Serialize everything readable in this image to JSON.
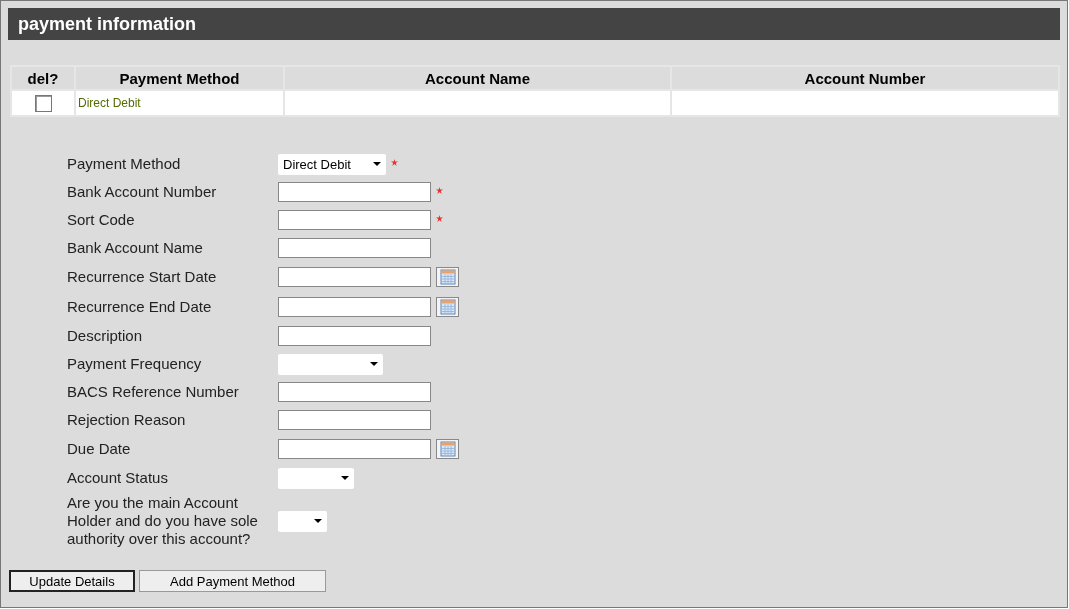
{
  "panel": {
    "title": "payment information"
  },
  "table": {
    "columns": [
      "del?",
      "Payment Method",
      "Account Name",
      "Account Number"
    ],
    "rows": [
      {
        "checked": false,
        "payment_method": "Direct Debit"
      }
    ]
  },
  "form": [
    {
      "label": "Payment Method",
      "kind": "select",
      "value": "Direct Debit",
      "required": true
    },
    {
      "label": "Bank Account Number",
      "kind": "text",
      "required": true
    },
    {
      "label": "Sort Code",
      "kind": "text",
      "required": true
    },
    {
      "label": "Bank Account Name",
      "kind": "text",
      "required": false
    },
    {
      "label": "Recurrence Start Date",
      "kind": "date",
      "required": false
    },
    {
      "label": "Recurrence End Date",
      "kind": "date",
      "required": false
    },
    {
      "label": "Description",
      "kind": "text",
      "required": false
    },
    {
      "label": "Payment Frequency",
      "kind": "select",
      "required": false
    },
    {
      "label": "BACS Reference Number",
      "kind": "text",
      "required": false
    },
    {
      "label": "Rejection Reason",
      "kind": "text",
      "required": false
    },
    {
      "label": "Due Date",
      "kind": "date",
      "required": false
    },
    {
      "label": "Account Status",
      "kind": "select",
      "required": false
    },
    {
      "label": "Are you the main Account Holder and do you have sole authority over this account?",
      "kind": "select",
      "required": false
    }
  ],
  "buttons": [
    "Update Details",
    "Add Payment Method"
  ]
}
